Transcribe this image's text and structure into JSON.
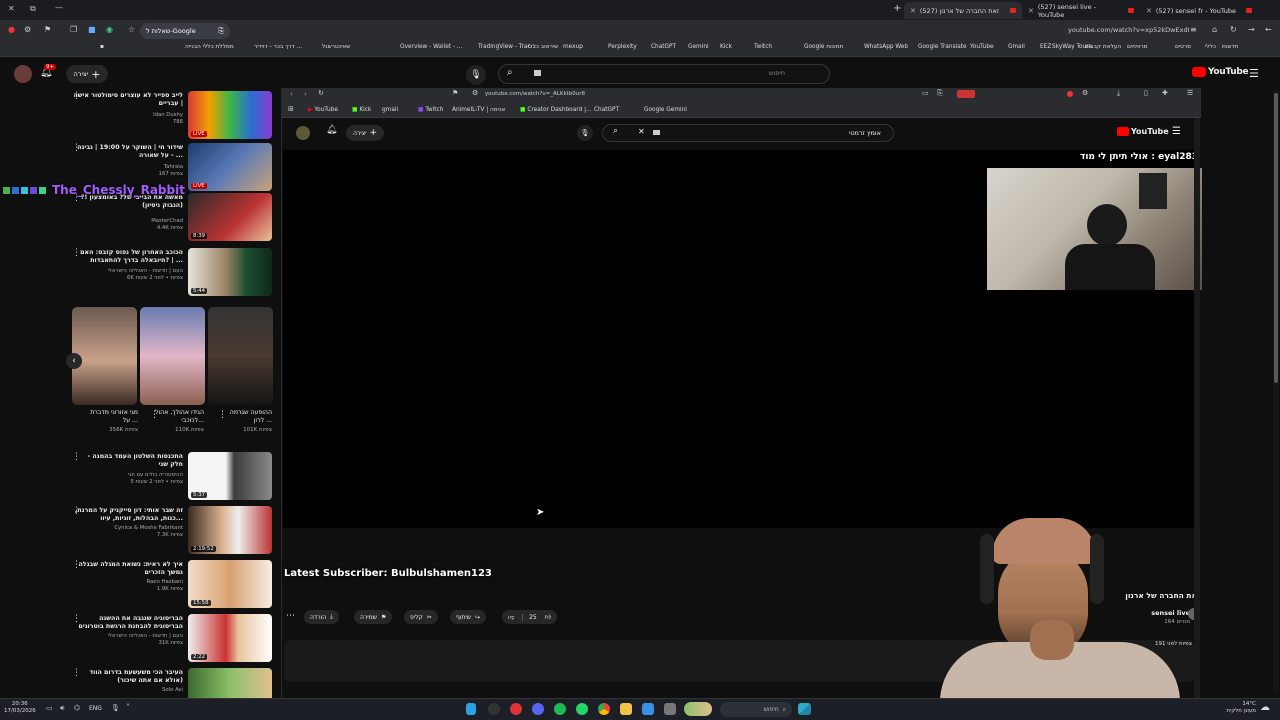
{
  "browser": {
    "tabs": [
      {
        "label": "(527) sensei fr - YouTube"
      },
      {
        "label": "(527) sensei live - YouTube"
      },
      {
        "label": "(527) זאת החברה של ארנון"
      }
    ],
    "search_chip": "שאלות ל-Google",
    "url": "youtube.com/watch?v=xp52kDwExdI",
    "bookmarks": [
      "חדשות",
      "כללי",
      "סרטים",
      "מרוויחים",
      "העלאת קבצים",
      "SkyWay Tours",
      "EEZ",
      "Gmail",
      "YouTube",
      "Google Translate",
      "WhatsApp Web",
      "Google תמונות",
      "Twitch",
      "Kick",
      "Gemini",
      "ChatGPT",
      "Perplexity",
      "mexup",
      "שיראוב כללי",
      "TradingView - Trac...",
      "Overview - Wallet - ...",
      "שאינטרשנל",
      "דרך בכר - דוידיר ...",
      "ממללת כללי הבנייה"
    ]
  },
  "youtube": {
    "logo": "YouTube",
    "search_placeholder": "חיפוש",
    "create_label": "יצירה",
    "notif_count": "9+",
    "feed": [
      {
        "title": "לייב ספייר לא עוצרים סימולטור אישה | עבריים",
        "channel": "Idan Dushy",
        "meta": "786",
        "duration": ""
      },
      {
        "title": "שידור חי | השוקר על 19:00 | גבינה על שאורה - ...",
        "channel": "Tahrala",
        "meta": "צפיות 167",
        "duration": ""
      },
      {
        "title": "מאשה את הבייבי של? באומצעון !? (הגבוק ניסיון)",
        "channel": "MasterChad",
        "meta": "4.4K צפיות",
        "duration": "8:39"
      },
      {
        "title": "הכוכב האחרון של נפוס קזבס: האם חיובאלה בדרך להתאבדות? | ...",
        "channel": "נועם | חדשות - האנליזה הישראלי",
        "meta": "6K צפיות • לפני 2 שעות",
        "duration": "5:44"
      },
      {
        "title": "התכנסות השלטון העמד בהמנה - חלק שני",
        "channel": "ההיסטוריה בולים עם חגי",
        "meta": "5 צפיות • לפני 2 שעות",
        "duration": "5:37"
      },
      {
        "title": "זה שבר אותי: דון סייקניק על המרגת, כנות, הבהלות, זוגיות, עיוו...",
        "channel": "Cynica & Moshe Fabrikant",
        "meta": "7.3K צפיות",
        "duration": "2:19:52"
      },
      {
        "title": "איך לא ראית: נשואת המגלה שבגלה נמשך הזכרים",
        "channel": "Raen Hasbani",
        "meta": "1.9K צפיות",
        "duration": "15:58"
      },
      {
        "title": "הבריסוגיה שנגבה את ההשגה הבריסוגית להבחנת הרגשת בוטרוגים",
        "channel": "נועם | חדשות - האנליזה הישראלי",
        "meta": "31K צפיות",
        "duration": "2:22"
      },
      {
        "title": "העיבר הכי משעשעת בדרום הווד (אולא אם אתה שיכור)",
        "channel": "Solo Avi",
        "meta": "",
        "duration": ""
      }
    ],
    "shorts": [
      {
        "title": "ההופעה שגרמה לרון ...",
        "views": "101K צפיות"
      },
      {
        "title": "הגידו אהולך, אהול לכוכבי...",
        "views": "110K צפיות"
      },
      {
        "title": "מגי אזורוני מדברת על ...",
        "views": "356K צפיות"
      }
    ]
  },
  "inner_browser": {
    "url": "youtube.com/watch?v=_ALKktb0ur8",
    "bookmarks": [
      "YouTube",
      "Kick",
      "gmail",
      "Twitch",
      "AnimeIL-TV | אנימה",
      "Creator Dashboard |...",
      "ChatGPT",
      "Google Gemini"
    ],
    "search_value": "אומץ זרמטי",
    "search_hint": "חיפוש"
  },
  "stream": {
    "donation": "אולי תיתן לי מוד : eyal283",
    "latest_sub": "Latest Subscriber: Bulbulshamen123",
    "like_count": "25",
    "actions": [
      "שיתוף",
      "קליפ",
      "שמירה",
      "הורדה"
    ],
    "video_title": "זאת החברה של ארנון",
    "channel": "sensei live",
    "subs": "164 מנויים",
    "views": "191 צפיות לפני"
  },
  "overlay": {
    "username": "The_Chessly_Rabbit"
  },
  "taskbar": {
    "time": "20:36",
    "date": "17/03/2026",
    "lang": "ENG",
    "weather": "14°C",
    "weather_desc": "מעונן חלקית",
    "search": "חיפוש"
  }
}
